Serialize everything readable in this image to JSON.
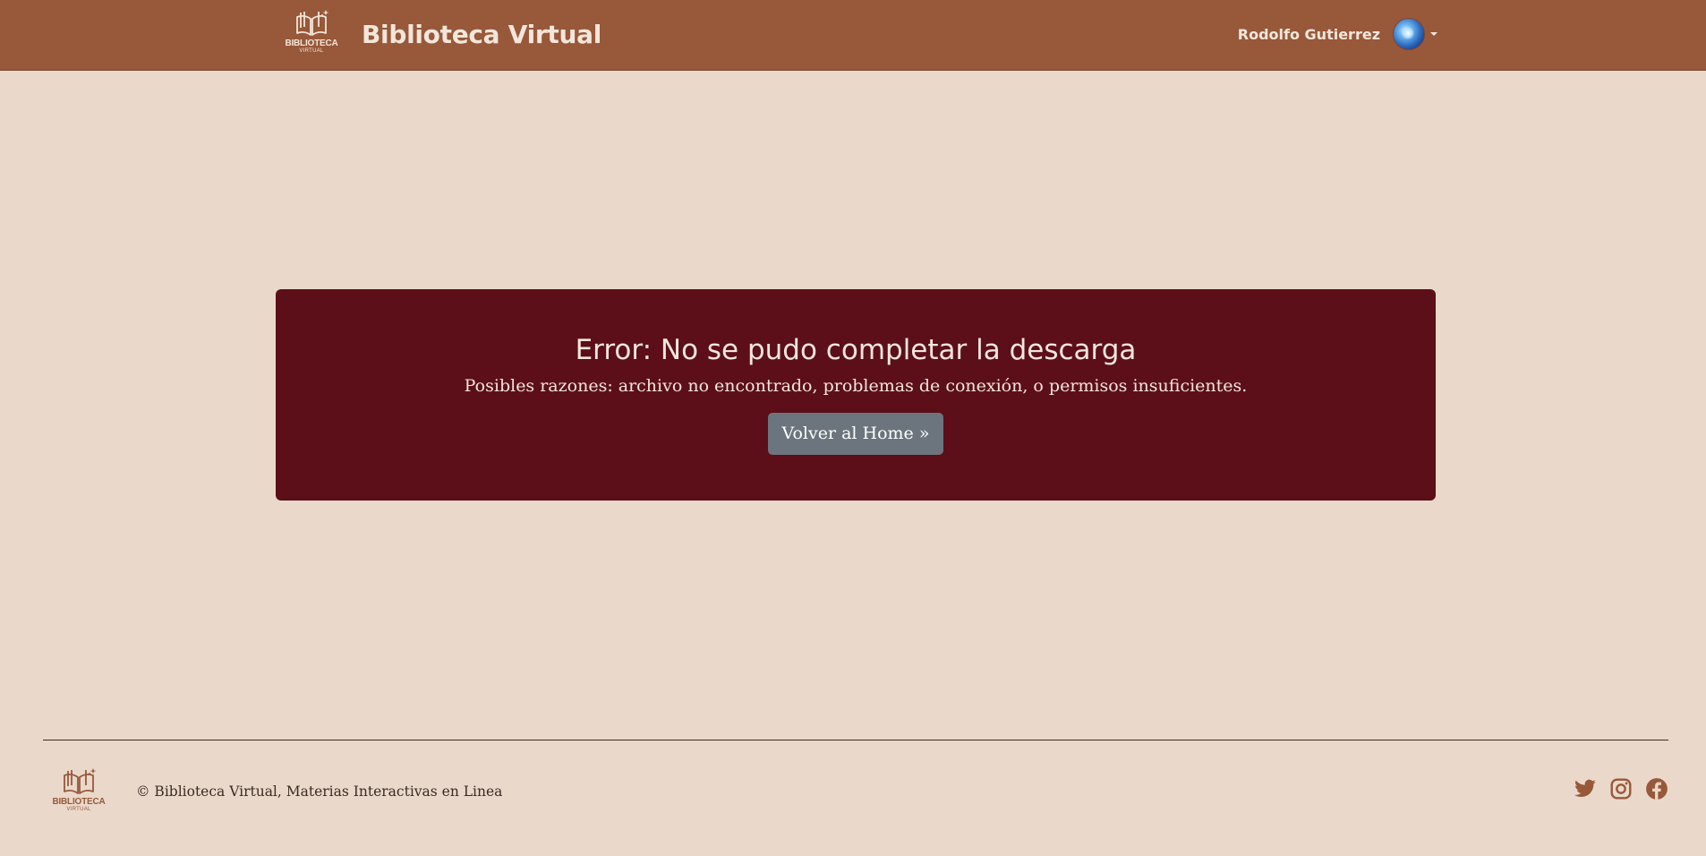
{
  "navbar": {
    "logo": {
      "word": "BIBLIOTECA",
      "sub": "VIRTUAL",
      "icon": "open-book-icon"
    },
    "brand_title": "Biblioteca Virtual",
    "user": {
      "name": "Rodolfo Gutierrez",
      "avatar_icon": "avatar",
      "menu_icon": "caret-down-icon"
    }
  },
  "error": {
    "title": "Error: No se pudo completar la descarga",
    "message": "Posibles razones: archivo no encontrado, problemas de conexión, o permisos insuficientes.",
    "button_label": "Volver al Home »"
  },
  "footer": {
    "logo": {
      "word": "BIBLIOTECA",
      "sub": "VIRTUAL",
      "icon": "open-book-icon"
    },
    "copyright": "© Biblioteca Virtual, Materias Interactivas en Linea",
    "socials": [
      "twitter-icon",
      "instagram-icon",
      "facebook-icon"
    ]
  },
  "colors": {
    "background": "#ead9cb",
    "navbar": "#98583a",
    "error_panel": "#5c0f18",
    "button": "#6c757d",
    "accent": "#98583a",
    "text_light": "#f3e6da"
  }
}
